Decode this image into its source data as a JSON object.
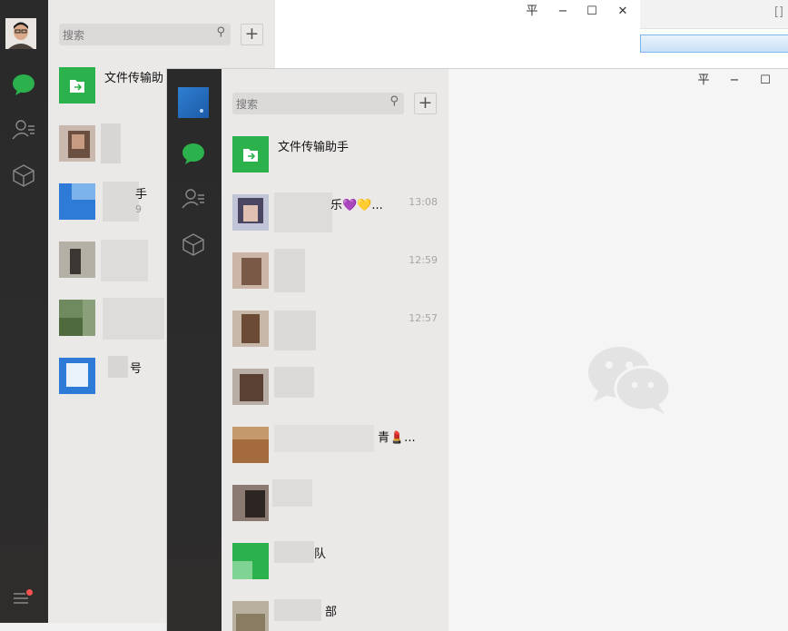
{
  "background_window": {
    "corner_glyph": "[]"
  },
  "window_back": {
    "title_buttons": {
      "pin": "平",
      "minimize": "−",
      "maximize": "☐",
      "close": "✕"
    },
    "search": {
      "placeholder": "搜索",
      "icon": "search-icon"
    },
    "add_label": "+",
    "chats": [
      {
        "name": "文件传输助",
        "time": "",
        "msg": ""
      },
      {
        "name": "",
        "time": "",
        "msg": ""
      },
      {
        "name": "手",
        "time": "",
        "msg": "9"
      },
      {
        "name": "",
        "time": "",
        "msg": ""
      },
      {
        "name": "",
        "time": "",
        "msg": ""
      },
      {
        "name": "号",
        "time": "",
        "msg": ""
      }
    ]
  },
  "window_front": {
    "title_buttons": {
      "pin": "平",
      "minimize": "−",
      "maximize": "☐"
    },
    "search": {
      "placeholder": "搜索",
      "icon": "search-icon"
    },
    "add_label": "+",
    "chats": [
      {
        "name": "文件传输助手",
        "time": "",
        "msg": ""
      },
      {
        "name": "乐💜💛...",
        "time": "13:08",
        "msg": ""
      },
      {
        "name": "",
        "time": "12:59",
        "msg": ""
      },
      {
        "name": "",
        "time": "12:57",
        "msg": ""
      },
      {
        "name": "",
        "time": "",
        "msg": ""
      },
      {
        "name": "青💄...",
        "time": "",
        "msg": ""
      },
      {
        "name": "",
        "time": "",
        "msg": ""
      },
      {
        "name": "队",
        "time": "",
        "msg": ""
      },
      {
        "name": "部",
        "time": "",
        "msg": ""
      }
    ],
    "watermark_icon": "wechat-logo-icon"
  },
  "colors": {
    "wechat_green": "#2bb24c",
    "nav_dark": "#2b2a2a",
    "list_bg": "#ebe9e8",
    "accent_blue": "#2b6fd6",
    "badge_red": "#fa5151"
  }
}
